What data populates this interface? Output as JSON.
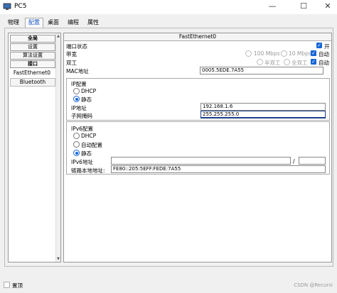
{
  "window": {
    "title": "PC5",
    "minimize": "—",
    "maximize": "☐",
    "close": "✕"
  },
  "tabs": [
    "物理",
    "配置",
    "桌面",
    "编程",
    "属性"
  ],
  "active_tab": "配置",
  "sidebar": {
    "items": [
      "全局",
      "设置",
      "算法设置",
      "接口",
      "FastEthernet0",
      "Bluetooth"
    ]
  },
  "panel": {
    "title": "FastEthernet0",
    "port_status_label": "端口状态",
    "port_on_label": "开",
    "bandwidth_label": "带宽",
    "bw_100": "100 Mbps",
    "bw_10": "10 Mbps",
    "auto1": "自动",
    "duplex_label": "双工",
    "half": "半双工",
    "full": "全双工",
    "auto2": "自动",
    "mac_label": "MAC地址",
    "mac_value": "0005.5EDE.7A55"
  },
  "ipv4": {
    "title": "IP配置",
    "dhcp": "DHCP",
    "static": "静态",
    "ip_label": "IP地址",
    "ip_value": "192.168.1.6",
    "mask_label": "子网掩码",
    "mask_value": "255.255.255.0"
  },
  "ipv6": {
    "title": "IPv6配置",
    "dhcp": "DHCP",
    "auto": "自动配置",
    "static": "静态",
    "addr_label": "IPv6地址",
    "addr_value": "",
    "slash": "/",
    "link_local_label": "链路本地地址:",
    "link_local_value": "FE80::205:5EFF:FEDE:7A55"
  },
  "bottom": {
    "checkbox_label": "置顶",
    "watermark": "CSDN @Recursi"
  },
  "colors": {
    "accent": "#1666d6",
    "tab_active": "#1a58c8"
  }
}
